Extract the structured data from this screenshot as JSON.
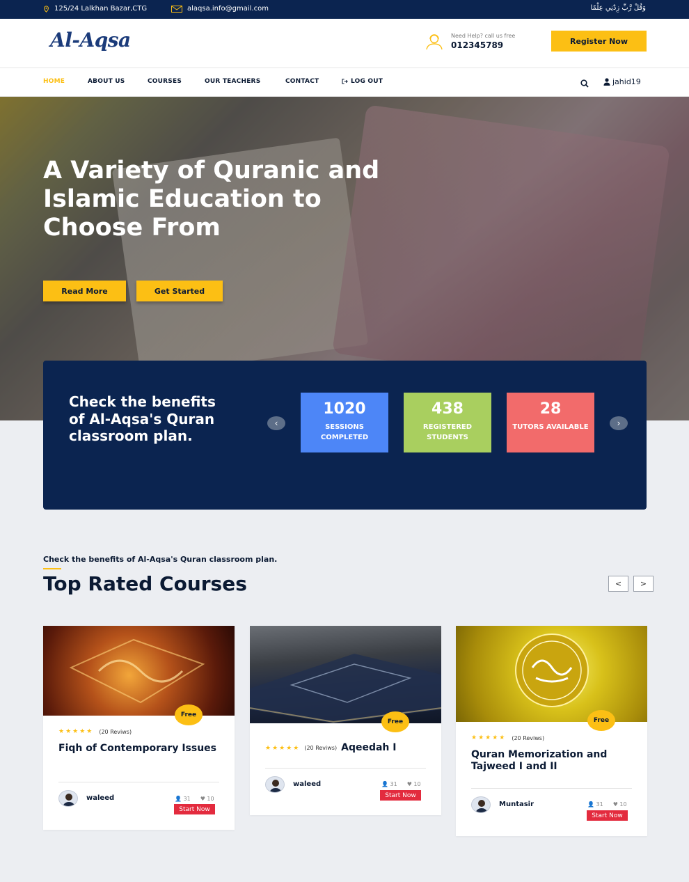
{
  "topbar": {
    "address": "125/24 Lalkhan Bazar,CTG",
    "email": "alaqsa.info@gmail.com",
    "arabic": "وَقُلْ رَّبِّ زِدْنِي عِلْمًا"
  },
  "header": {
    "logo": "Al-Aqsa",
    "help_label": "Need Help? call us free",
    "phone": "012345789",
    "register_label": "Register Now"
  },
  "nav": {
    "items": [
      "HOME",
      "ABOUT US",
      "COURSES",
      "OUR TEACHERS",
      "CONTACT",
      "LOG OUT"
    ],
    "username": "jahid19"
  },
  "hero": {
    "title": "A Variety of Quranic and Islamic Education to Choose From",
    "read_more": "Read More",
    "get_started": "Get Started"
  },
  "stats": {
    "heading": "Check the benefits of Al-Aqsa's Quran classroom plan.",
    "cards": [
      {
        "value": "1020",
        "label": "SESSIONS COMPLETED",
        "color": "#4d86f7"
      },
      {
        "value": "438",
        "label": "REGISTERED STUDENTS",
        "color": "#a9cf5f"
      },
      {
        "value": "28",
        "label": "TUTORS AVAILABLE",
        "color": "#f26b6b"
      }
    ]
  },
  "courses": {
    "subheading": "Check the benefits of Al-Aqsa's Quran classroom plan.",
    "title": "Top Rated Courses",
    "items": [
      {
        "badge": "Free",
        "stars": "★★★★★",
        "reviews": "(20 Reviws)",
        "title": "Fiqh of Contemporary Issues",
        "author": "waleed",
        "students": "31",
        "likes": "10",
        "cta": "Start Now"
      },
      {
        "badge": "Free",
        "stars": "★★★★★",
        "reviews": "(20 Reviws)",
        "title": "Aqeedah I",
        "author": "waleed",
        "students": "31",
        "likes": "10",
        "cta": "Start Now"
      },
      {
        "badge": "Free",
        "stars": "★★★★★",
        "reviews": "(20 Reviws)",
        "title": "Quran Memorization and Tajweed I and II",
        "author": "Muntasir",
        "students": "31",
        "likes": "10",
        "cta": "Start Now"
      }
    ]
  },
  "colors": {
    "navy": "#0b2450",
    "accent": "#fcbf14",
    "danger": "#e32b3e"
  }
}
